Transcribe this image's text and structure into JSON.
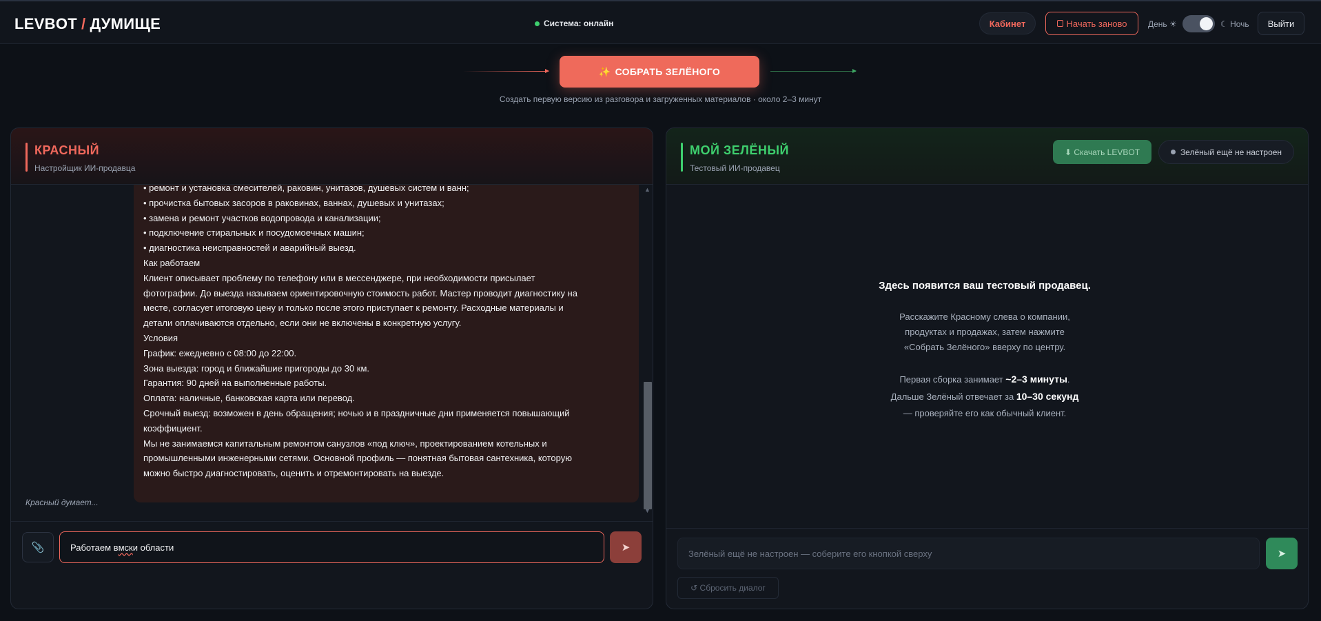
{
  "header": {
    "logo_left": "LEVBOT",
    "logo_slash": "/",
    "logo_right": "ДУМИЩЕ",
    "system_status": "Система: онлайн",
    "cabinet_label": "Кабинет",
    "restart_label": "Начать заново",
    "day_label": "День ☀",
    "night_label": "☾ Ночь",
    "theme_night_enabled": true,
    "exit_label": "Выйти"
  },
  "assemble": {
    "button_label": "СОБРАТЬ ЗЕЛЁНОГО",
    "button_icon": "✨",
    "subtitle": "Создать первую версию из разговора и загруженных материалов · около 2–3 минут"
  },
  "red_panel": {
    "title": "КРАСНЫЙ",
    "subtitle": "Настройщик ИИ-продавца",
    "message_lines": [
      "• ремонт и установка смесителей, раковин, унитазов, душевых систем и ванн;",
      "• прочистка бытовых засоров в раковинах, ваннах, душевых и унитазах;",
      "• замена и ремонт участков водопровода и канализации;",
      "• подключение стиральных и посудомоечных машин;",
      "• диагностика неисправностей и аварийный выезд.",
      "Как работаем",
      "Клиент описывает проблему по телефону или в мессенджере, при необходимости присылает",
      "фотографии. До выезда называем ориентировочную стоимость работ. Мастер проводит диагностику на",
      "месте, согласует итоговую цену и только после этого приступает к ремонту. Расходные материалы и",
      "детали оплачиваются отдельно, если они не включены в конкретную услугу.",
      "Условия",
      "График: ежедневно с 08:00 до 22:00.",
      "Зона выезда: город и ближайшие пригороды до 30 км.",
      "Гарантия: 90 дней на выполненные работы.",
      "Оплата: наличные, банковская карта или перевод.",
      "Срочный выезд: возможен в день обращения; ночью и в праздничные дни применяется повышающий",
      "коэффициент.",
      "Мы не занимаемся капитальным ремонтом санузлов «под ключ», проектированием котельных и",
      "промышленными инженерными сетями. Основной профиль — понятная бытовая сантехника, которую",
      "можно быстро диагностировать, оценить и отремонтировать на выезде."
    ],
    "thinking_text": "Красный думает...",
    "input_before": "Работаем в ",
    "input_misspelled": "мск",
    "input_after": " и области",
    "attach_icon": "paperclip-icon",
    "send_icon": "send-icon",
    "scroll_position": 0.59
  },
  "green_panel": {
    "title": "МОЙ ЗЕЛЁНЫЙ",
    "subtitle": "Тестовый ИИ-продавец",
    "download_label": "⬇ Скачать LEVBOT",
    "status_label": "Зелёный ещё не настроен",
    "placeholder_title": "Здесь появится ваш тестовый продавец.",
    "placeholder_desc_1": "Расскажите Красному слева о компании,",
    "placeholder_desc_2": "продуктах и продажах, затем нажмите",
    "placeholder_desc_3": "«Собрать Зелёного» вверху по центру.",
    "timing_1_before": "Первая сборка занимает ",
    "timing_1_value": "~2–3 минуты",
    "timing_1_after": ".",
    "timing_2_before": "Дальше Зелёный отвечает за ",
    "timing_2_value": "10–30 секунд",
    "timing_3": "— проверяйте его как обычный клиент.",
    "input_placeholder": "Зелёный ещё не настроен — соберите его кнопкой сверху",
    "reset_label": "↺ Сбросить диалог",
    "send_icon": "send-icon"
  },
  "colors": {
    "accent_red": "#f0685c",
    "accent_green": "#3ecf6e",
    "background": "#0d1117"
  }
}
